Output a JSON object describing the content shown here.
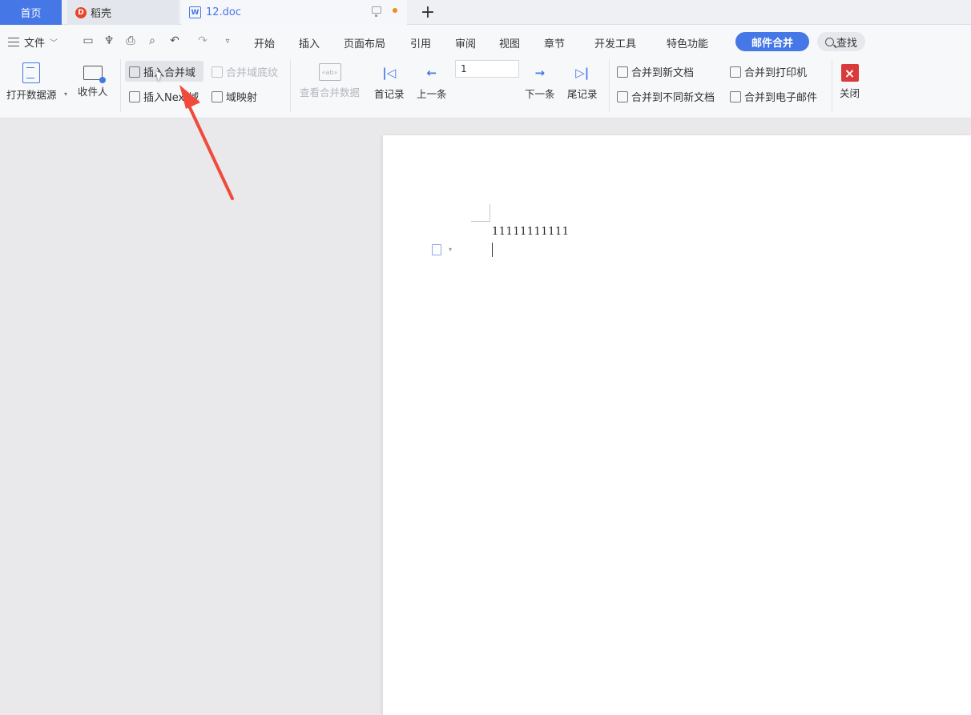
{
  "tabs": {
    "home": "首页",
    "daoke": "稻壳",
    "daoke_logo": "D",
    "doc": "12.doc",
    "doc_icon": "W",
    "new_tab": "+"
  },
  "menu": {
    "file": "文件",
    "items": [
      "开始",
      "插入",
      "页面布局",
      "引用",
      "审阅",
      "视图",
      "章节",
      "开发工具",
      "特色功能"
    ],
    "mail_merge": "邮件合并",
    "search": "查找"
  },
  "ribbon": {
    "open_datasource": "打开数据源",
    "recipients": "收件人",
    "insert_merge_field": "插入合并域",
    "insert_next_field": "插入Next域",
    "merge_field_shading": "合并域底纹",
    "field_mapping": "域映射",
    "view_merged_data": "查看合并数据",
    "view_icon_text": "«ab»",
    "first_record": "首记录",
    "prev_record": "上一条",
    "record_number": "1",
    "next_record": "下一条",
    "last_record": "尾记录",
    "merge_to_new_doc": "合并到新文档",
    "merge_to_different_docs": "合并到不同新文档",
    "merge_to_printer": "合并到打印机",
    "merge_to_email": "合并到电子邮件",
    "close": "关闭",
    "close_icon": "×"
  },
  "document": {
    "text": "11111111111"
  },
  "colors": {
    "accent": "#4677e6",
    "arrow": "#f04a3c",
    "close": "#d93a3a"
  }
}
